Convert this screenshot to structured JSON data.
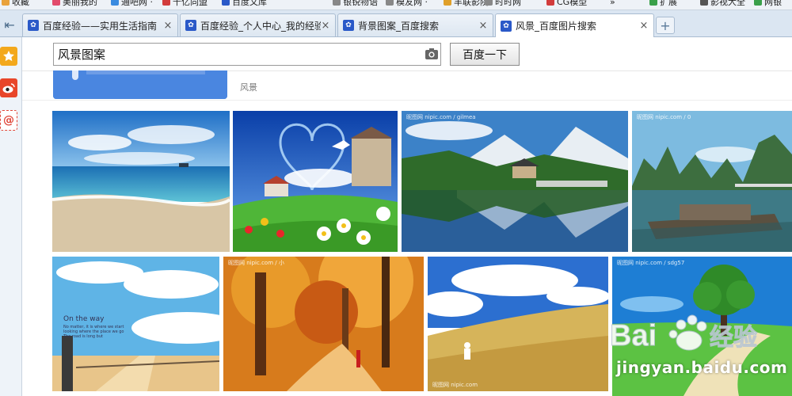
{
  "bookmarks": [
    {
      "label": "收藏",
      "color": "#e9a23b"
    },
    {
      "label": "美丽我的",
      "color": "#e24b6b"
    },
    {
      "label": "通吧网 ·",
      "color": "#3a8be0"
    },
    {
      "label": "千亿同盟",
      "color": "#d23c3c"
    },
    {
      "label": "百度文库",
      "color": "#2a59c8"
    },
    {
      "label": "银锐物语",
      "color": "#888888"
    },
    {
      "label": "模友网 ·",
      "color": "#888888"
    },
    {
      "label": "丰联影院",
      "color": "#e0a02a"
    },
    {
      "label": "时时网",
      "color": "#888888"
    },
    {
      "label": "CG模型",
      "color": "#d23c3c"
    },
    {
      "label": "»",
      "color": ""
    },
    {
      "label": "扩展",
      "color": "#3aa04a"
    },
    {
      "label": "影视大全",
      "color": "#555555"
    },
    {
      "label": "网银",
      "color": "#3aa04a"
    }
  ],
  "tabs": [
    {
      "label": "百度经验——实用生活指南",
      "close": "×"
    },
    {
      "label": "百度经验_个人中心_我的经验",
      "close": "×"
    },
    {
      "label": "背景图案_百度搜索",
      "close": "×"
    },
    {
      "label": "风景_百度图片搜索",
      "close": "×"
    }
  ],
  "new_tab_label": "+",
  "back_label": "⇤",
  "search": {
    "value": "风景图案",
    "button_label": "百度一下"
  },
  "banner_tag": "风景",
  "watermarks": {
    "img3": "昵图网 nipic.com / gilmea",
    "img4": "昵图网 nipic.com / 0",
    "img6": "昵图网 nipic.com / 小",
    "img7": "昵图网 nipic.com",
    "img8": "昵图网 nipic.com / sdg57"
  },
  "onway": {
    "title": "On the way",
    "lines": [
      "No matter, it is where we start",
      "looking where the place we go",
      "The road is long but"
    ]
  },
  "baidu": {
    "brand": "Bai",
    "brand2": "经验",
    "url": "jingyan.baidu.com"
  },
  "colors": {
    "tabstrip": "#dbe6f2",
    "accent": "#2a59c8"
  }
}
